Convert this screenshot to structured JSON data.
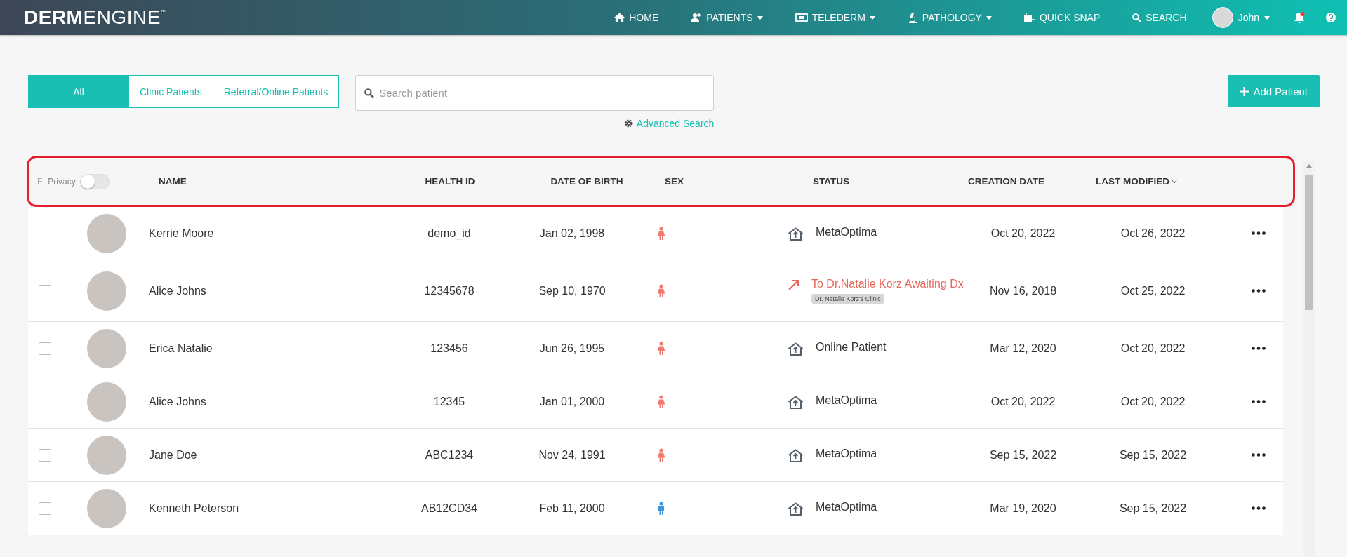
{
  "navbar": {
    "brand": {
      "bold": "DERM",
      "light": "ENGINE",
      "mark": "™"
    },
    "items": [
      {
        "kind": "home",
        "label": "HOME",
        "dropdown": false
      },
      {
        "kind": "patients",
        "label": "PATIENTS",
        "dropdown": true
      },
      {
        "kind": "telederm",
        "label": "TELEDERM",
        "dropdown": true
      },
      {
        "kind": "pathology",
        "label": "PATHOLOGY",
        "dropdown": true
      },
      {
        "kind": "snap",
        "label": "QUICK SNAP",
        "dropdown": false
      },
      {
        "kind": "search",
        "label": "SEARCH",
        "dropdown": false
      }
    ],
    "user": {
      "name": "John"
    }
  },
  "filter_tabs": [
    {
      "label": "All",
      "selected": true
    },
    {
      "label": "Clinic Patients",
      "selected": false
    },
    {
      "label": "Referral/Online Patients",
      "selected": false
    }
  ],
  "search": {
    "placeholder": "Search patient"
  },
  "advanced_search": "Advanced Search",
  "add_button": "Add Patient",
  "table": {
    "highlighted": true,
    "cut_label": "F",
    "privacy": {
      "label": "Privacy",
      "on": false
    },
    "columns": [
      {
        "label": "NAME",
        "sorted": false
      },
      {
        "label": "HEALTH ID",
        "sorted": false
      },
      {
        "label": "DATE OF BIRTH",
        "sorted": false
      },
      {
        "label": "SEX",
        "sorted": false
      },
      {
        "label": "STATUS",
        "sorted": false
      },
      {
        "label": "CREATION DATE",
        "sorted": false
      },
      {
        "label": "LAST MODIFIED",
        "sorted": true
      }
    ],
    "rows": [
      {
        "has_checkbox": false,
        "name": "Kerrie Moore",
        "health_id": "demo_id",
        "dob": "Jan 02, 1998",
        "female": true,
        "status": {
          "kind": "clinic",
          "text": "MetaOptima"
        },
        "created": "Oct 20, 2022",
        "modified": "Oct 26, 2022"
      },
      {
        "has_checkbox": true,
        "checked": false,
        "name": "Alice Johns",
        "health_id": "12345678",
        "dob": "Sep 10, 1970",
        "female": true,
        "status": {
          "kind": "referral",
          "text": "To Dr.Natalie Korz Awaiting Dx",
          "tag": "Dr. Natalie Korz's Clinic"
        },
        "created": "Nov 16, 2018",
        "modified": "Oct 25, 2022"
      },
      {
        "has_checkbox": true,
        "checked": false,
        "name": "Erica Natalie",
        "health_id": "123456",
        "dob": "Jun 26, 1995",
        "female": true,
        "status": {
          "kind": "clinic",
          "text": "Online Patient"
        },
        "created": "Mar 12, 2020",
        "modified": "Oct 20, 2022"
      },
      {
        "has_checkbox": true,
        "checked": false,
        "name": "Alice Johns",
        "health_id": "12345",
        "dob": "Jan 01, 2000",
        "female": true,
        "status": {
          "kind": "clinic",
          "text": "MetaOptima"
        },
        "created": "Oct 20, 2022",
        "modified": "Oct 20, 2022"
      },
      {
        "has_checkbox": true,
        "checked": false,
        "name": "Jane Doe",
        "health_id": "ABC1234",
        "dob": "Nov 24, 1991",
        "female": true,
        "status": {
          "kind": "clinic",
          "text": "MetaOptima"
        },
        "created": "Sep 15, 2022",
        "modified": "Sep 15, 2022"
      },
      {
        "has_checkbox": true,
        "checked": false,
        "name": "Kenneth Peterson",
        "health_id": "AB12CD34",
        "dob": "Feb 11, 2000",
        "female": false,
        "status": {
          "kind": "clinic",
          "text": "MetaOptima"
        },
        "created": "Mar 19, 2020",
        "modified": "Sep 15, 2022"
      }
    ]
  }
}
